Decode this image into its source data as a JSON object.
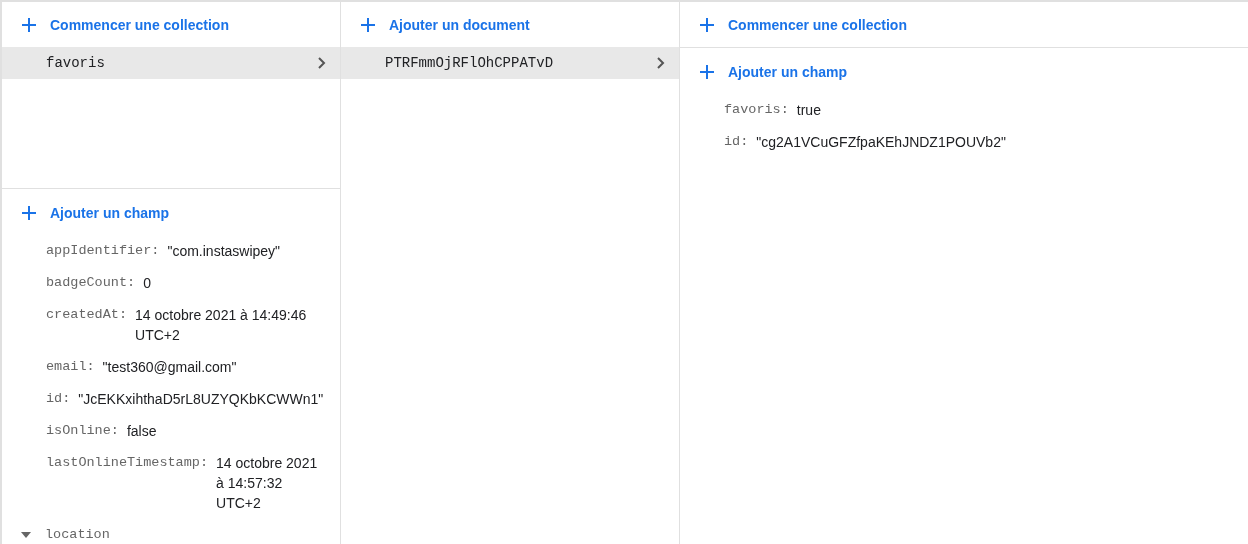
{
  "collections": {
    "action": "Commencer une collection",
    "items": [
      {
        "name": "favoris",
        "selected": true
      }
    ]
  },
  "root_document": {
    "action": "Ajouter un champ",
    "fields": [
      {
        "kind": "value",
        "key": "appIdentifier:",
        "value": "\"com.instaswipey\""
      },
      {
        "kind": "value",
        "key": "badgeCount:",
        "value": "0"
      },
      {
        "kind": "value",
        "key": "createdAt:",
        "value": "14 octobre 2021 à 14:49:46 UTC+2"
      },
      {
        "kind": "value",
        "key": "email:",
        "value": "\"test360@gmail.com\""
      },
      {
        "kind": "value",
        "key": "id:",
        "value": "\"JcEKKxihthaD5rL8UZYQKbKCWWn1\""
      },
      {
        "kind": "value",
        "key": "isOnline:",
        "value": "false"
      },
      {
        "kind": "value",
        "key": "lastOnlineTimestamp:",
        "value": "14 octobre 2021 à 14:57:32 UTC+2"
      },
      {
        "kind": "map",
        "key": "location",
        "expanded": true
      }
    ]
  },
  "documents": {
    "action": "Ajouter un document",
    "items": [
      {
        "name": "PTRFmmOjRFlOhCPPATvD",
        "selected": true
      }
    ]
  },
  "document": {
    "collection_action": "Commencer une collection",
    "field_action": "Ajouter un champ",
    "fields": [
      {
        "kind": "value",
        "key": "favoris:",
        "value": "true"
      },
      {
        "kind": "value",
        "key": "id:",
        "value": "\"cg2A1VCuGFZfpaKEhJNDZ1POUVb2\""
      }
    ]
  }
}
